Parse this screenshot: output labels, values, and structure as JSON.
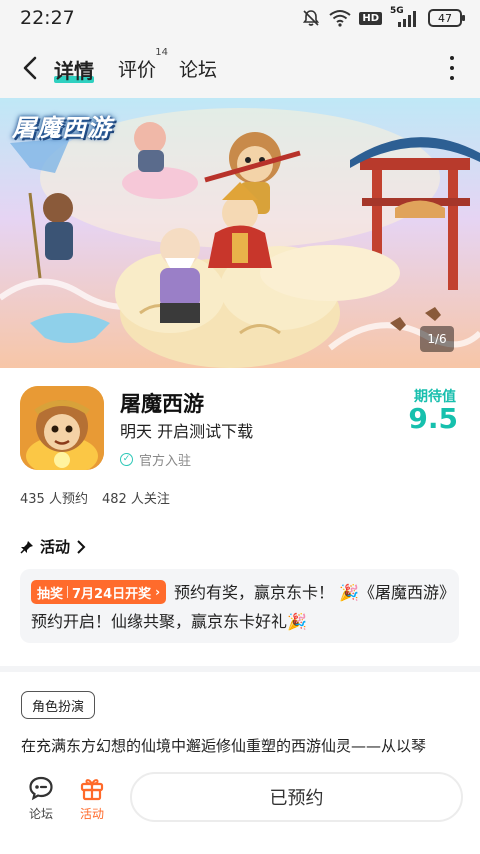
{
  "status_bar": {
    "time": "22:27",
    "hd": "HD",
    "network": "5G",
    "battery": "47"
  },
  "nav": {
    "tabs": [
      {
        "label": "详情",
        "active": true
      },
      {
        "label": "评价",
        "badge": "14"
      },
      {
        "label": "论坛"
      }
    ]
  },
  "banner": {
    "title": "屠魔西游",
    "page_indicator": "1/6"
  },
  "app": {
    "name": "屠魔西游",
    "subtitle": "明天 开启测试下载",
    "official": "官方入驻",
    "expect_label": "期待值",
    "expect_score": "9.5",
    "reservations": "435 人预约",
    "follows": "482 人关注"
  },
  "activity": {
    "header": "活动",
    "tag_type": "抽奖",
    "tag_date": "7月24日开奖",
    "text": "预约有奖，赢京东卡！ 🎉《屠魔西游》预约开启！仙缘共聚，赢京东卡好礼🎉"
  },
  "description": {
    "genre": "角色扮演",
    "text": "在充满东方幻想的仙境中邂逅修仙重塑的西游仙灵——从以琴"
  },
  "bottom_bar": {
    "forum_label": "论坛",
    "activity_label": "活动",
    "reserve_label": "已预约"
  },
  "colors": {
    "accent": "#2fd0c0",
    "score": "#16c0ad",
    "tag": "#ff6b2c"
  }
}
